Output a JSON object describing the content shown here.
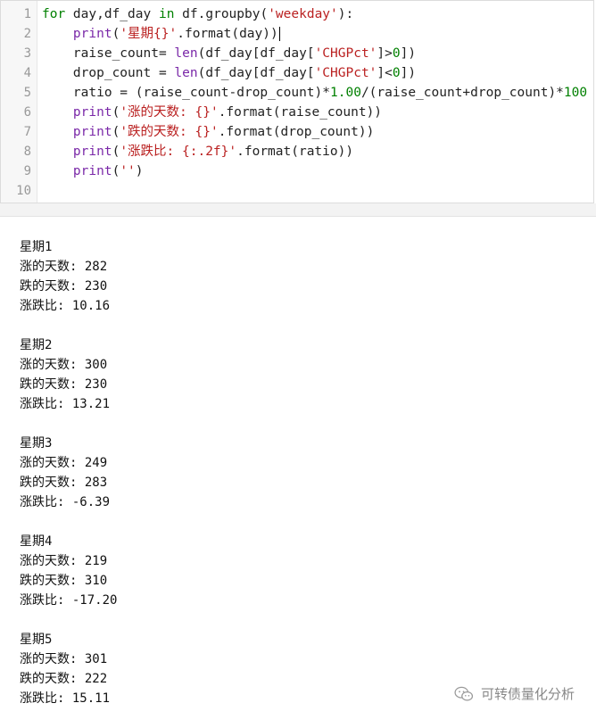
{
  "editor": {
    "line_numbers": [
      "1",
      "2",
      "3",
      "4",
      "5",
      "6",
      "7",
      "8",
      "9",
      "10"
    ],
    "lines": [
      [
        {
          "t": "kw",
          "v": "for"
        },
        {
          "t": "txt",
          "v": " day,df_day "
        },
        {
          "t": "kw",
          "v": "in"
        },
        {
          "t": "txt",
          "v": " df.groupby("
        },
        {
          "t": "str",
          "v": "'weekday'"
        },
        {
          "t": "txt",
          "v": "):"
        }
      ],
      [
        {
          "t": "txt",
          "v": "    "
        },
        {
          "t": "fn",
          "v": "print"
        },
        {
          "t": "txt",
          "v": "("
        },
        {
          "t": "str",
          "v": "'星期{}'"
        },
        {
          "t": "txt",
          "v": ".format(day))"
        }
      ],
      [
        {
          "t": "txt",
          "v": "    raise_count= "
        },
        {
          "t": "fn",
          "v": "len"
        },
        {
          "t": "txt",
          "v": "(df_day[df_day["
        },
        {
          "t": "str",
          "v": "'CHGPct'"
        },
        {
          "t": "txt",
          "v": "]>"
        },
        {
          "t": "num",
          "v": "0"
        },
        {
          "t": "txt",
          "v": "])"
        }
      ],
      [
        {
          "t": "txt",
          "v": "    drop_count = "
        },
        {
          "t": "fn",
          "v": "len"
        },
        {
          "t": "txt",
          "v": "(df_day[df_day["
        },
        {
          "t": "str",
          "v": "'CHGPct'"
        },
        {
          "t": "txt",
          "v": "]<"
        },
        {
          "t": "num",
          "v": "0"
        },
        {
          "t": "txt",
          "v": "])"
        }
      ],
      [
        {
          "t": "txt",
          "v": "    ratio = (raise_count-drop_count)*"
        },
        {
          "t": "num",
          "v": "1.00"
        },
        {
          "t": "txt",
          "v": "/(raise_count+drop_count)*"
        },
        {
          "t": "num",
          "v": "100"
        }
      ],
      [
        {
          "t": "txt",
          "v": "    "
        },
        {
          "t": "fn",
          "v": "print"
        },
        {
          "t": "txt",
          "v": "("
        },
        {
          "t": "str",
          "v": "'涨的天数: {}'"
        },
        {
          "t": "txt",
          "v": ".format(raise_count))"
        }
      ],
      [
        {
          "t": "txt",
          "v": "    "
        },
        {
          "t": "fn",
          "v": "print"
        },
        {
          "t": "txt",
          "v": "("
        },
        {
          "t": "str",
          "v": "'跌的天数: {}'"
        },
        {
          "t": "txt",
          "v": ".format(drop_count))"
        }
      ],
      [
        {
          "t": "txt",
          "v": "    "
        },
        {
          "t": "fn",
          "v": "print"
        },
        {
          "t": "txt",
          "v": "("
        },
        {
          "t": "str",
          "v": "'涨跌比: {:.2f}'"
        },
        {
          "t": "txt",
          "v": ".format(ratio))"
        }
      ],
      [
        {
          "t": "txt",
          "v": "    "
        },
        {
          "t": "fn",
          "v": "print"
        },
        {
          "t": "txt",
          "v": "("
        },
        {
          "t": "str",
          "v": "''"
        },
        {
          "t": "txt",
          "v": ")"
        }
      ],
      []
    ]
  },
  "output": [
    {
      "lines": [
        "星期1",
        "涨的天数: 282",
        "跌的天数: 230",
        "涨跌比: 10.16"
      ]
    },
    {
      "lines": [
        "星期2",
        "涨的天数: 300",
        "跌的天数: 230",
        "涨跌比: 13.21"
      ]
    },
    {
      "lines": [
        "星期3",
        "涨的天数: 249",
        "跌的天数: 283",
        "涨跌比: -6.39"
      ]
    },
    {
      "lines": [
        "星期4",
        "涨的天数: 219",
        "跌的天数: 310",
        "涨跌比: -17.20"
      ]
    },
    {
      "lines": [
        "星期5",
        "涨的天数: 301",
        "跌的天数: 222",
        "涨跌比: 15.11"
      ]
    }
  ],
  "watermark": {
    "text": "可转债量化分析",
    "icon": "wechat-icon"
  },
  "colors": {
    "keyword": "#008000",
    "builtin": "#7a28a8",
    "string": "#ba2121",
    "number": "#008000"
  }
}
